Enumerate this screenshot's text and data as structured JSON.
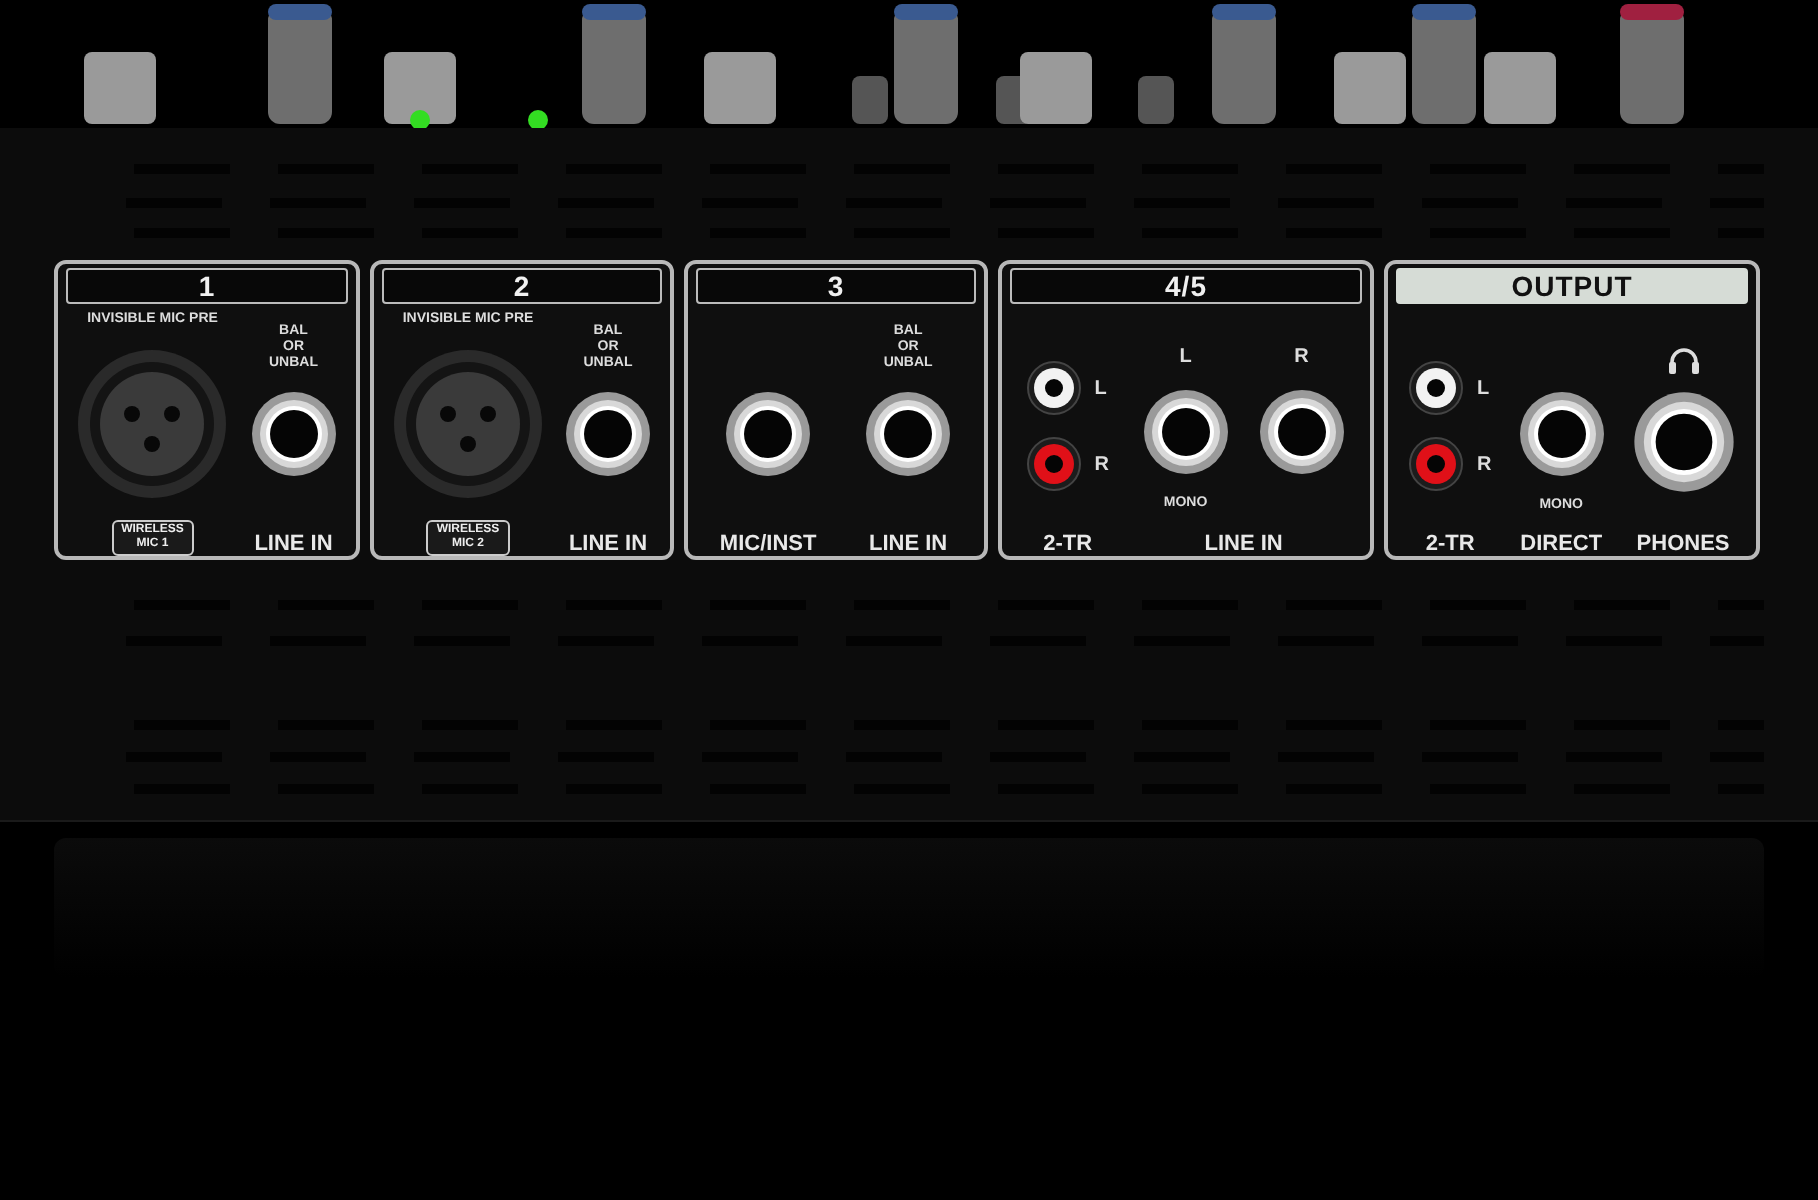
{
  "panels": [
    {
      "title": "1",
      "highlighted": false,
      "columns": [
        {
          "kind": "xlr",
          "arc": "INVISIBLE MIC PRE",
          "badge_top": "WIRELESS",
          "badge_bottom": "MIC 1"
        },
        {
          "kind": "jack",
          "top": [
            "BAL",
            "OR",
            "UNBAL"
          ],
          "label": "LINE IN"
        }
      ]
    },
    {
      "title": "2",
      "highlighted": false,
      "columns": [
        {
          "kind": "xlr",
          "arc": "INVISIBLE MIC PRE",
          "badge_top": "WIRELESS",
          "badge_bottom": "MIC 2"
        },
        {
          "kind": "jack",
          "top": [
            "BAL",
            "OR",
            "UNBAL"
          ],
          "label": "LINE IN"
        }
      ]
    },
    {
      "title": "3",
      "highlighted": false,
      "columns": [
        {
          "kind": "jack",
          "label": "MIC/INST"
        },
        {
          "kind": "jack",
          "top": [
            "BAL",
            "OR",
            "UNBAL"
          ],
          "label": "LINE IN"
        }
      ]
    },
    {
      "title": "4/5",
      "highlighted": false,
      "columns": [
        {
          "kind": "rca",
          "jacks": [
            {
              "side": "L",
              "color": "#f2f2f2"
            },
            {
              "side": "R",
              "color": "#e01018"
            }
          ],
          "label": "2-TR"
        },
        {
          "kind": "stereo",
          "left": "L",
          "right": "R",
          "mono": "MONO",
          "label": "LINE IN"
        }
      ]
    },
    {
      "title": "OUTPUT",
      "highlighted": true,
      "columns": [
        {
          "kind": "rca",
          "jacks": [
            {
              "side": "L",
              "color": "#f2f2f2"
            },
            {
              "side": "R",
              "color": "#e01018"
            }
          ],
          "label": "2-TR"
        },
        {
          "kind": "jack",
          "mono": "MONO",
          "label": "DIRECT"
        },
        {
          "kind": "phones",
          "label": "PHONES"
        }
      ]
    }
  ]
}
